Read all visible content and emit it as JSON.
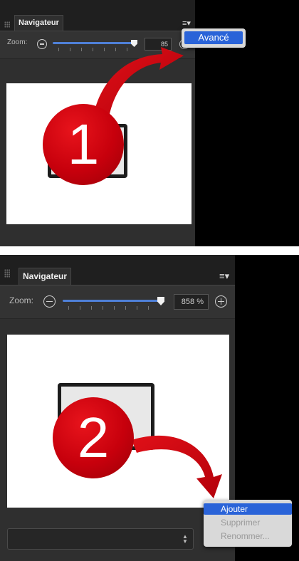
{
  "panel": {
    "tab_title": "Navigateur",
    "zoom_label": "Zoom:",
    "zoom_value_top": "85",
    "zoom_value": "858 %",
    "icons": [
      "grip-icon",
      "panel-menu-icon",
      "zoom-out-icon",
      "zoom-in-icon",
      "stepper-icon"
    ]
  },
  "top_menu": {
    "items": [
      {
        "label": "Avancé",
        "selected": true
      }
    ]
  },
  "bottom_menu": {
    "items": [
      {
        "label": "Ajouter",
        "selected": true
      },
      {
        "label": "Supprimer",
        "disabled": true
      },
      {
        "label": "Renommer...",
        "disabled": true
      }
    ]
  },
  "callouts": {
    "step1": "1",
    "step2": "2"
  },
  "colors": {
    "panel_bg": "#2f2f2f",
    "accent": "#4f80d8",
    "selection": "#2a63d8",
    "callout_red": "#c7000c"
  }
}
